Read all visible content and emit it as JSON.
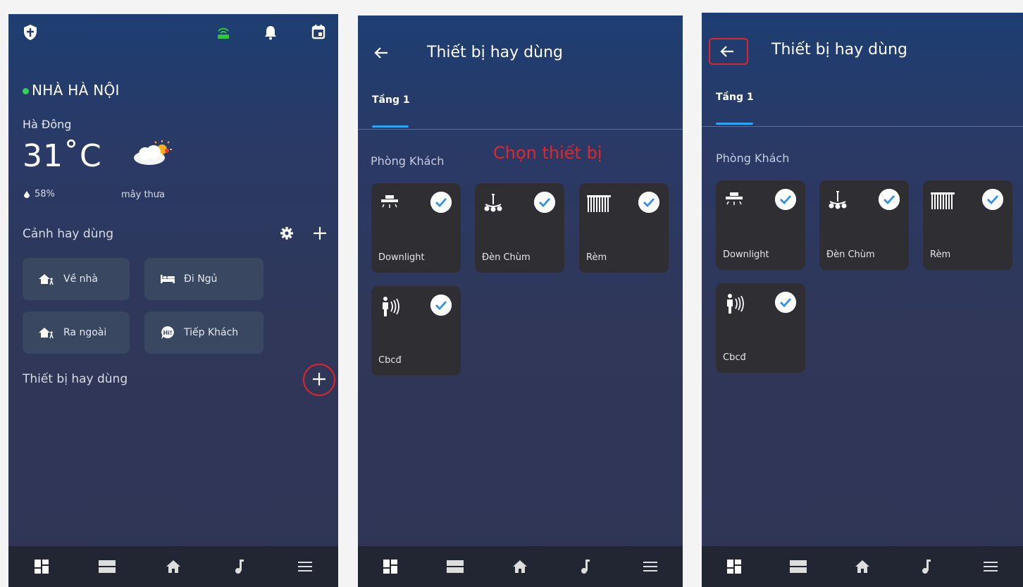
{
  "home": {
    "location": "NHÀ HÀ NỘI",
    "district": "Hà Đông",
    "temperature": "31˚C",
    "humidity": "58%",
    "condition": "mây thưa",
    "scenes_title": "Cảnh hay dùng",
    "scenes": [
      {
        "label": "Về nhà",
        "icon": "home-walk-icon"
      },
      {
        "label": "Đi Ngủ",
        "icon": "bed-icon"
      },
      {
        "label": "Ra ngoài",
        "icon": "home-walk-icon"
      },
      {
        "label": "Tiếp Khách",
        "icon": "hi-bubble-icon"
      }
    ],
    "devices_title": "Thiết bị hay dùng",
    "status_colors": {
      "online_dot": "#34d058",
      "router": "#2fc83a",
      "highlight": "#e0242c"
    }
  },
  "picker": {
    "title": "Thiết bị hay dùng",
    "tab": "Tầng 1",
    "room": "Phòng Khách",
    "annotation": "Chọn thiết bị",
    "devices": [
      {
        "name": "Downlight",
        "icon": "downlight-icon",
        "checked": true
      },
      {
        "name": "Đèn Chùm",
        "icon": "chandelier-icon",
        "checked": true
      },
      {
        "name": "Rèm",
        "icon": "curtain-icon",
        "checked": true
      },
      {
        "name": "Cbcđ",
        "icon": "motion-sensor-icon",
        "checked": true
      }
    ]
  },
  "confirm": {
    "title": "Thiết bị hay dùng",
    "tab": "Tầng 1",
    "room": "Phòng Khách",
    "devices": [
      {
        "name": "Downlight",
        "icon": "downlight-icon",
        "checked": true
      },
      {
        "name": "Đèn Chùm",
        "icon": "chandelier-icon",
        "checked": true
      },
      {
        "name": "Rèm",
        "icon": "curtain-icon",
        "checked": true
      },
      {
        "name": "Cbcđ",
        "icon": "motion-sensor-icon",
        "checked": true
      }
    ]
  },
  "navbar": [
    "dashboard-icon",
    "rooms-icon",
    "home-icon",
    "music-icon",
    "menu-icon"
  ],
  "colors": {
    "accent": "#2aa6f2",
    "check_fill": "#2f8fee",
    "tile_bg": "#2e2e33"
  }
}
